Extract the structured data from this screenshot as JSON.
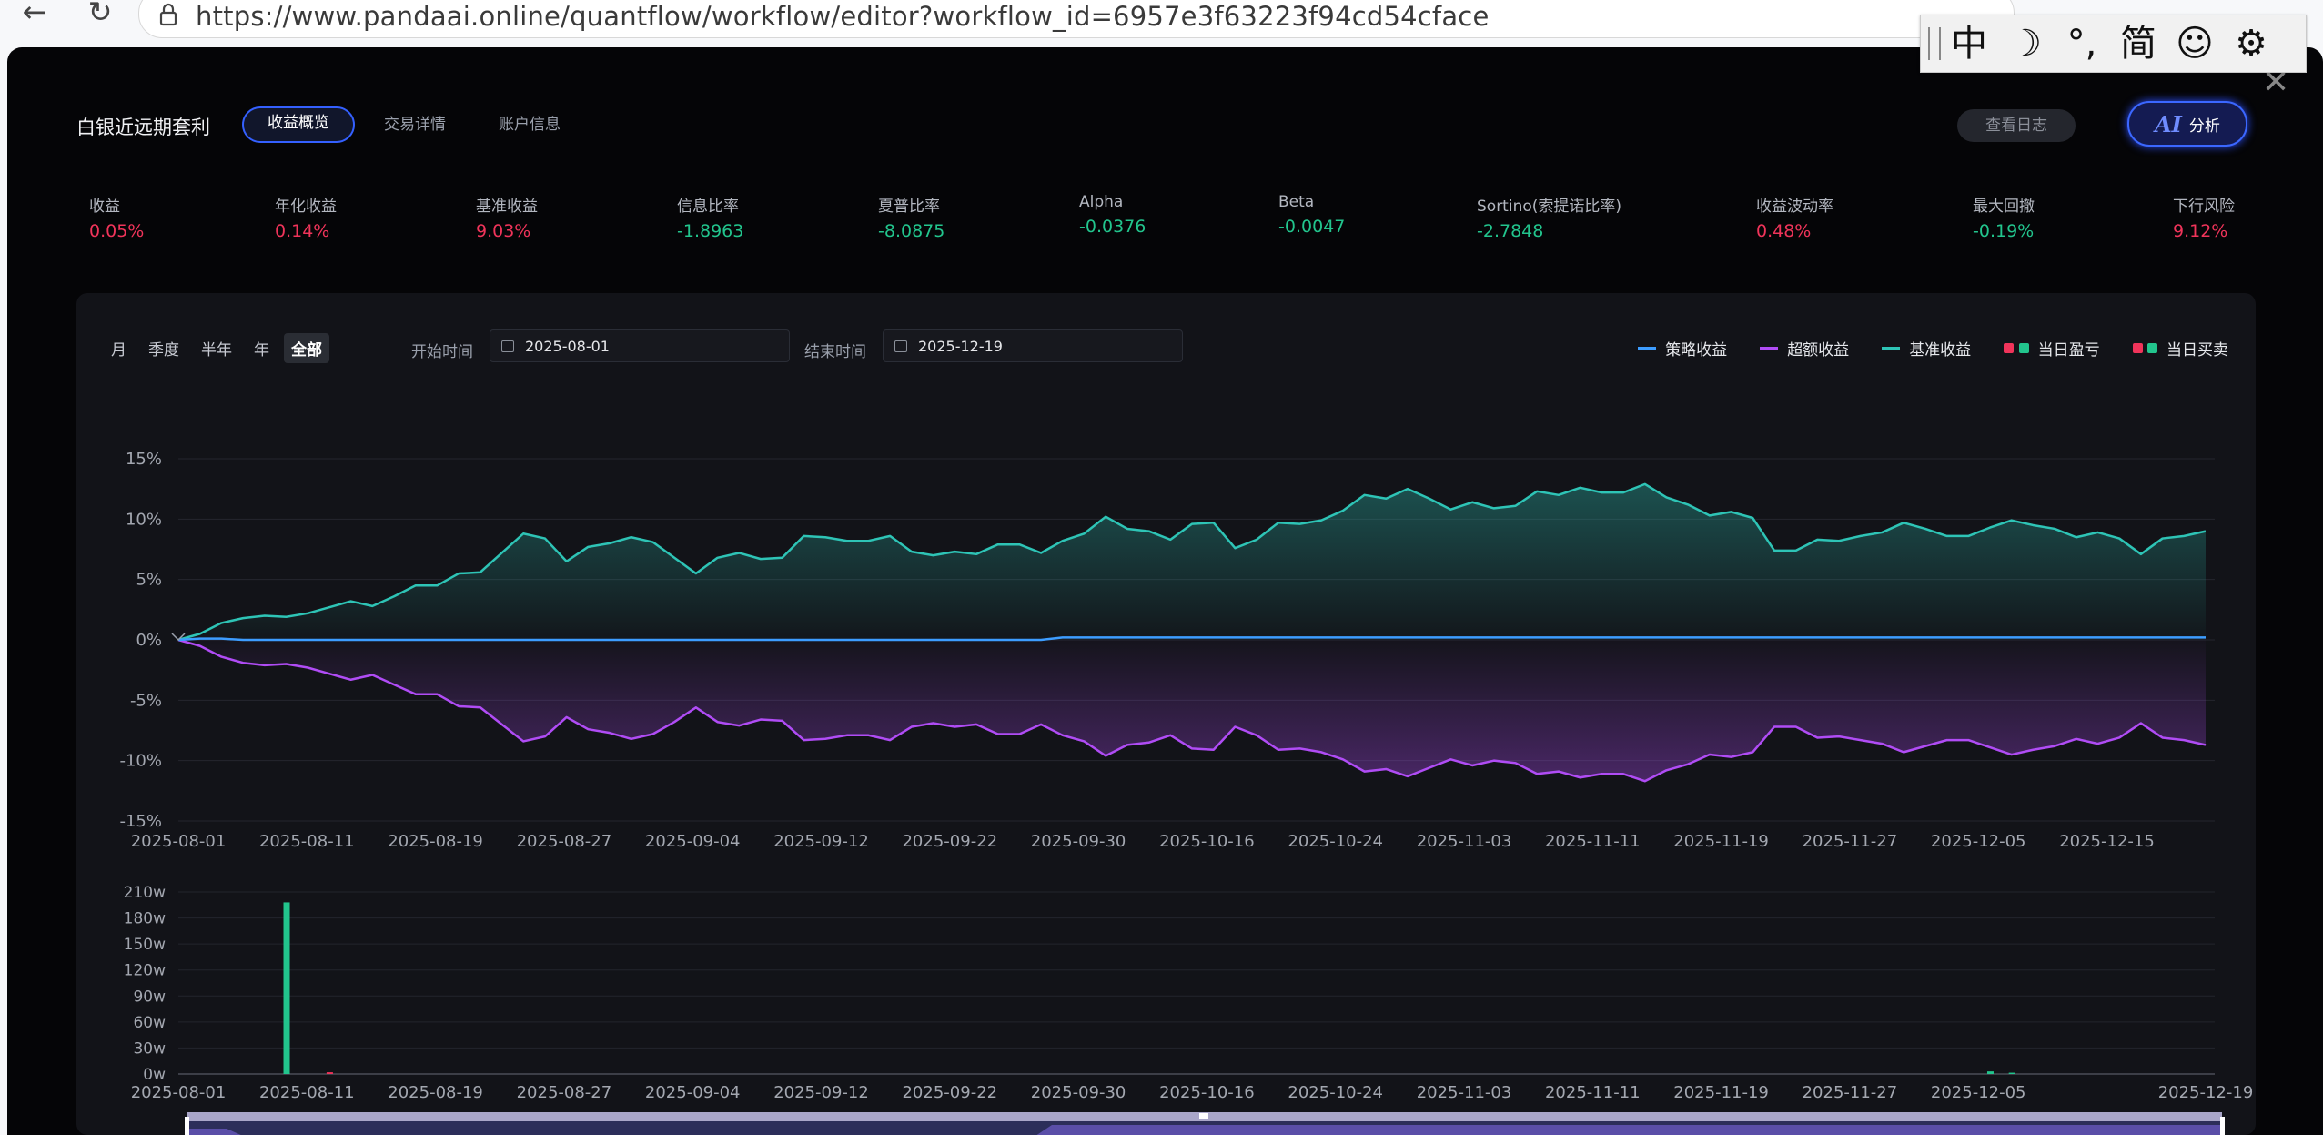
{
  "browser": {
    "url": "https://www.pandaai.online/quantflow/workflow/editor?workflow_id=6957e3f63223f94cd54cface"
  },
  "ime": {
    "items": [
      "中",
      "☽",
      "°,",
      "简",
      "☺",
      "⚙"
    ]
  },
  "header": {
    "title": "白银近远期套利",
    "tabs": [
      {
        "label": "收益概览",
        "active": true
      },
      {
        "label": "交易详情",
        "active": false
      },
      {
        "label": "账户信息",
        "active": false
      }
    ],
    "log_button": "查看日志",
    "ai_mark": "AI",
    "ai_label": "分析"
  },
  "stats": [
    {
      "label": "收益",
      "value": "0.05%",
      "tone": "red"
    },
    {
      "label": "年化收益",
      "value": "0.14%",
      "tone": "red"
    },
    {
      "label": "基准收益",
      "value": "9.03%",
      "tone": "red"
    },
    {
      "label": "信息比率",
      "value": "-1.8963",
      "tone": "green"
    },
    {
      "label": "夏普比率",
      "value": "-8.0875",
      "tone": "green"
    },
    {
      "label": "Alpha",
      "value": "-0.0376",
      "tone": "green"
    },
    {
      "label": "Beta",
      "value": "-0.0047",
      "tone": "green"
    },
    {
      "label": "Sortino(索提诺比率)",
      "value": "-2.7848",
      "tone": "green"
    },
    {
      "label": "收益波动率",
      "value": "0.48%",
      "tone": "red"
    },
    {
      "label": "最大回撤",
      "value": "-0.19%",
      "tone": "green"
    },
    {
      "label": "下行风险",
      "value": "9.12%",
      "tone": "red"
    }
  ],
  "controls": {
    "periods": [
      {
        "label": "月",
        "active": false
      },
      {
        "label": "季度",
        "active": false
      },
      {
        "label": "半年",
        "active": false
      },
      {
        "label": "年",
        "active": false
      },
      {
        "label": "全部",
        "active": true
      }
    ],
    "start_label": "开始时间",
    "start_value": "2025-08-01",
    "end_label": "结束时间",
    "end_value": "2025-12-19"
  },
  "legend": [
    {
      "label": "策略收益",
      "kind": "line",
      "color": "#3d9dff"
    },
    {
      "label": "超额收益",
      "kind": "line",
      "color": "#b04cf5"
    },
    {
      "label": "基准收益",
      "kind": "line",
      "color": "#2ec4b6"
    },
    {
      "label": "当日盈亏",
      "kind": "squares",
      "colors": [
        "#f0345a",
        "#22c58d"
      ]
    },
    {
      "label": "当日买卖",
      "kind": "squares",
      "colors": [
        "#f0345a",
        "#22c58d"
      ]
    }
  ],
  "colors": {
    "strategy": "#3d9dff",
    "excess": "#b04cf5",
    "benchmark": "#2ec4b6",
    "up": "#f0345a",
    "down": "#22c58d"
  },
  "chart_data": [
    {
      "type": "line",
      "title": "",
      "x_ticks": [
        "2025-08-01",
        "2025-08-11",
        "2025-08-19",
        "2025-08-27",
        "2025-09-04",
        "2025-09-12",
        "2025-09-22",
        "2025-09-30",
        "2025-10-16",
        "2025-10-24",
        "2025-11-03",
        "2025-11-11",
        "2025-11-19",
        "2025-11-27",
        "2025-12-05",
        "2025-12-15"
      ],
      "y_ticks": [
        "15%",
        "10%",
        "5%",
        "0%",
        "-5%",
        "-10%",
        "-15%"
      ],
      "ylim": [
        -15,
        15
      ],
      "series": [
        {
          "name": "基准收益",
          "values": [
            0,
            0.5,
            1.4,
            1.8,
            2.0,
            1.9,
            2.2,
            2.7,
            3.2,
            2.8,
            3.6,
            4.5,
            4.5,
            5.5,
            5.6,
            7.2,
            8.8,
            8.4,
            6.5,
            7.7,
            8.0,
            8.5,
            8.1,
            6.8,
            5.5,
            6.8,
            7.2,
            6.7,
            6.8,
            8.6,
            8.5,
            8.2,
            8.2,
            8.6,
            7.3,
            7.0,
            7.3,
            7.1,
            7.9,
            7.9,
            7.2,
            8.2,
            8.8,
            10.2,
            9.2,
            9.0,
            8.3,
            9.6,
            9.7,
            7.6,
            8.3,
            9.7,
            9.6,
            9.9,
            10.7,
            12.0,
            11.7,
            12.5,
            11.7,
            10.8,
            11.4,
            10.9,
            11.1,
            12.3,
            12.0,
            12.6,
            12.2,
            12.2,
            12.9,
            11.8,
            11.2,
            10.3,
            10.6,
            10.1,
            7.4,
            7.4,
            8.3,
            8.2,
            8.6,
            8.9,
            9.7,
            9.2,
            8.6,
            8.6,
            9.3,
            9.9,
            9.5,
            9.2,
            8.5,
            8.9,
            8.4,
            7.1,
            8.4,
            8.6,
            9.0
          ]
        },
        {
          "name": "策略收益",
          "values": [
            0,
            0.1,
            0.1,
            0,
            0,
            0,
            0,
            0,
            0,
            0,
            0,
            0,
            0,
            0,
            0,
            0,
            0,
            0,
            0,
            0,
            0,
            0,
            0,
            0,
            0,
            0,
            0,
            0,
            0,
            0,
            0,
            0,
            0,
            0,
            0,
            0,
            0,
            0,
            0,
            0,
            0,
            0.2,
            0.2,
            0.2,
            0.2,
            0.2,
            0.2,
            0.2,
            0.2,
            0.2,
            0.2,
            0.2,
            0.2,
            0.2,
            0.2,
            0.2,
            0.2,
            0.2,
            0.2,
            0.2,
            0.2,
            0.2,
            0.2,
            0.2,
            0.2,
            0.2,
            0.2,
            0.2,
            0.2,
            0.2,
            0.2,
            0.2,
            0.2,
            0.2,
            0.2,
            0.2,
            0.2,
            0.2,
            0.2,
            0.2,
            0.2,
            0.2,
            0.2,
            0.2,
            0.2,
            0.2,
            0.2,
            0.2,
            0.2,
            0.2,
            0.2,
            0.2,
            0.2,
            0.2,
            0.2
          ]
        },
        {
          "name": "超额收益",
          "values": [
            0,
            -0.5,
            -1.4,
            -1.9,
            -2.1,
            -2.0,
            -2.3,
            -2.8,
            -3.3,
            -2.9,
            -3.7,
            -4.5,
            -4.5,
            -5.5,
            -5.6,
            -7.0,
            -8.4,
            -8.0,
            -6.4,
            -7.4,
            -7.7,
            -8.2,
            -7.8,
            -6.8,
            -5.6,
            -6.8,
            -7.1,
            -6.6,
            -6.7,
            -8.3,
            -8.2,
            -7.9,
            -7.9,
            -8.3,
            -7.2,
            -6.9,
            -7.2,
            -7.0,
            -7.8,
            -7.8,
            -7.0,
            -7.9,
            -8.4,
            -9.6,
            -8.7,
            -8.5,
            -7.9,
            -9.0,
            -9.1,
            -7.2,
            -7.9,
            -9.1,
            -9.0,
            -9.3,
            -9.9,
            -10.9,
            -10.7,
            -11.3,
            -10.6,
            -9.9,
            -10.4,
            -10.0,
            -10.2,
            -11.1,
            -10.9,
            -11.4,
            -11.1,
            -11.1,
            -11.7,
            -10.8,
            -10.3,
            -9.5,
            -9.7,
            -9.3,
            -7.2,
            -7.2,
            -8.1,
            -8.0,
            -8.3,
            -8.6,
            -9.3,
            -8.8,
            -8.3,
            -8.3,
            -8.9,
            -9.5,
            -9.1,
            -8.8,
            -8.2,
            -8.6,
            -8.1,
            -6.9,
            -8.1,
            -8.3,
            -8.7
          ]
        }
      ]
    },
    {
      "type": "bar",
      "title": "",
      "x_ticks": [
        "2025-08-01",
        "2025-08-11",
        "2025-08-19",
        "2025-08-27",
        "2025-09-04",
        "2025-09-12",
        "2025-09-22",
        "2025-09-30",
        "2025-10-16",
        "2025-10-24",
        "2025-11-03",
        "2025-11-11",
        "2025-11-19",
        "2025-11-27",
        "2025-12-05",
        "2025-12-19"
      ],
      "y_ticks": [
        "210w",
        "180w",
        "150w",
        "120w",
        "90w",
        "60w",
        "30w",
        "0w"
      ],
      "ylim": [
        0,
        210
      ],
      "series": [
        {
          "name": "当日买卖",
          "values": [
            {
              "index": 5,
              "value": 198,
              "tone": "down"
            },
            {
              "index": 7,
              "value": 2,
              "tone": "up"
            },
            {
              "index": 84,
              "value": 3,
              "tone": "down"
            },
            {
              "index": 85,
              "value": 1.5,
              "tone": "down"
            }
          ]
        }
      ],
      "point_count": 95
    }
  ]
}
